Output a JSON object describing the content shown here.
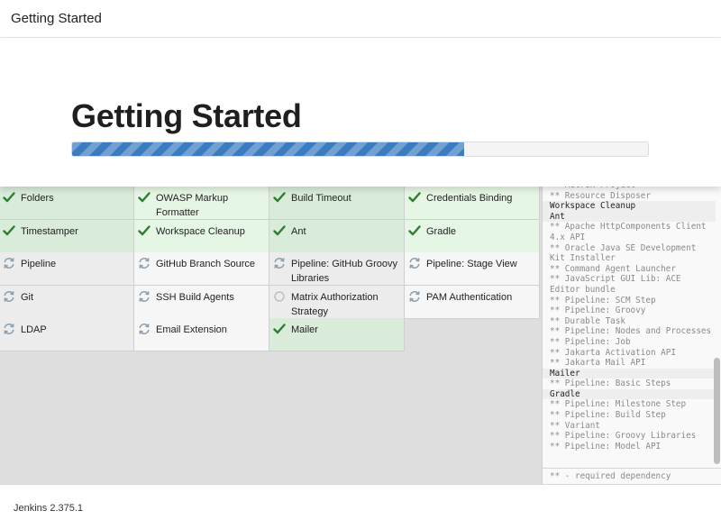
{
  "window": {
    "title": "Getting Started"
  },
  "header": {
    "title": "Getting Started",
    "progress": 0.68
  },
  "colors": {
    "accent": "#3b7bbf",
    "done": "#2e7d32",
    "pending_icon": "#8a9fb0"
  },
  "plugins": [
    {
      "label": "Folders",
      "status": "done",
      "icon": "check-icon"
    },
    {
      "label": "OWASP Markup Formatter",
      "status": "done",
      "icon": "check-icon"
    },
    {
      "label": "Build Timeout",
      "status": "done",
      "icon": "check-icon"
    },
    {
      "label": "Credentials Binding",
      "status": "done",
      "icon": "check-icon"
    },
    {
      "label": "Timestamper",
      "status": "done",
      "icon": "check-icon"
    },
    {
      "label": "Workspace Cleanup",
      "status": "done",
      "icon": "check-icon"
    },
    {
      "label": "Ant",
      "status": "done",
      "icon": "check-icon"
    },
    {
      "label": "Gradle",
      "status": "done",
      "icon": "check-icon"
    },
    {
      "label": "Pipeline",
      "status": "pending",
      "icon": "refresh-icon"
    },
    {
      "label": "GitHub Branch Source",
      "status": "pending",
      "icon": "refresh-icon"
    },
    {
      "label": "Pipeline: GitHub Groovy Libraries",
      "status": "pending",
      "icon": "refresh-icon"
    },
    {
      "label": "Pipeline: Stage View",
      "status": "pending",
      "icon": "refresh-icon"
    },
    {
      "label": "Git",
      "status": "pending",
      "icon": "refresh-icon"
    },
    {
      "label": "SSH Build Agents",
      "status": "pending",
      "icon": "refresh-icon"
    },
    {
      "label": "Matrix Authorization Strategy",
      "status": "pending",
      "icon": "circle-icon"
    },
    {
      "label": "PAM Authentication",
      "status": "pending",
      "icon": "refresh-icon"
    },
    {
      "label": "LDAP",
      "status": "pending",
      "icon": "refresh-icon"
    },
    {
      "label": "Email Extension",
      "status": "pending",
      "icon": "refresh-icon"
    },
    {
      "label": "Mailer",
      "status": "done",
      "icon": "check-icon"
    }
  ],
  "log": {
    "lines": [
      {
        "text": "** Matrix Project",
        "heading": false
      },
      {
        "text": "** Resource Disposer",
        "heading": false
      },
      {
        "text": "Workspace Cleanup",
        "heading": true
      },
      {
        "text": "Ant",
        "heading": true
      },
      {
        "text": "** Apache HttpComponents Client 4.x API",
        "heading": false
      },
      {
        "text": "** Oracle Java SE Development Kit Installer",
        "heading": false
      },
      {
        "text": "** Command Agent Launcher",
        "heading": false
      },
      {
        "text": "** JavaScript GUI Lib: ACE Editor bundle",
        "heading": false
      },
      {
        "text": "** Pipeline: SCM Step",
        "heading": false
      },
      {
        "text": "** Pipeline: Groovy",
        "heading": false
      },
      {
        "text": "** Durable Task",
        "heading": false
      },
      {
        "text": "** Pipeline: Nodes and Processes",
        "heading": false
      },
      {
        "text": "** Pipeline: Job",
        "heading": false
      },
      {
        "text": "** Jakarta Activation API",
        "heading": false
      },
      {
        "text": "** Jakarta Mail API",
        "heading": false
      },
      {
        "text": "Mailer",
        "heading": true
      },
      {
        "text": "** Pipeline: Basic Steps",
        "heading": false
      },
      {
        "text": "Gradle",
        "heading": true
      },
      {
        "text": "** Pipeline: Milestone Step",
        "heading": false
      },
      {
        "text": "** Pipeline: Build Step",
        "heading": false
      },
      {
        "text": "** Variant",
        "heading": false
      },
      {
        "text": "** Pipeline: Groovy Libraries",
        "heading": false
      },
      {
        "text": "** Pipeline: Model API",
        "heading": false
      }
    ],
    "footer": "** - required dependency"
  },
  "footer": {
    "version": "Jenkins 2.375.1"
  }
}
